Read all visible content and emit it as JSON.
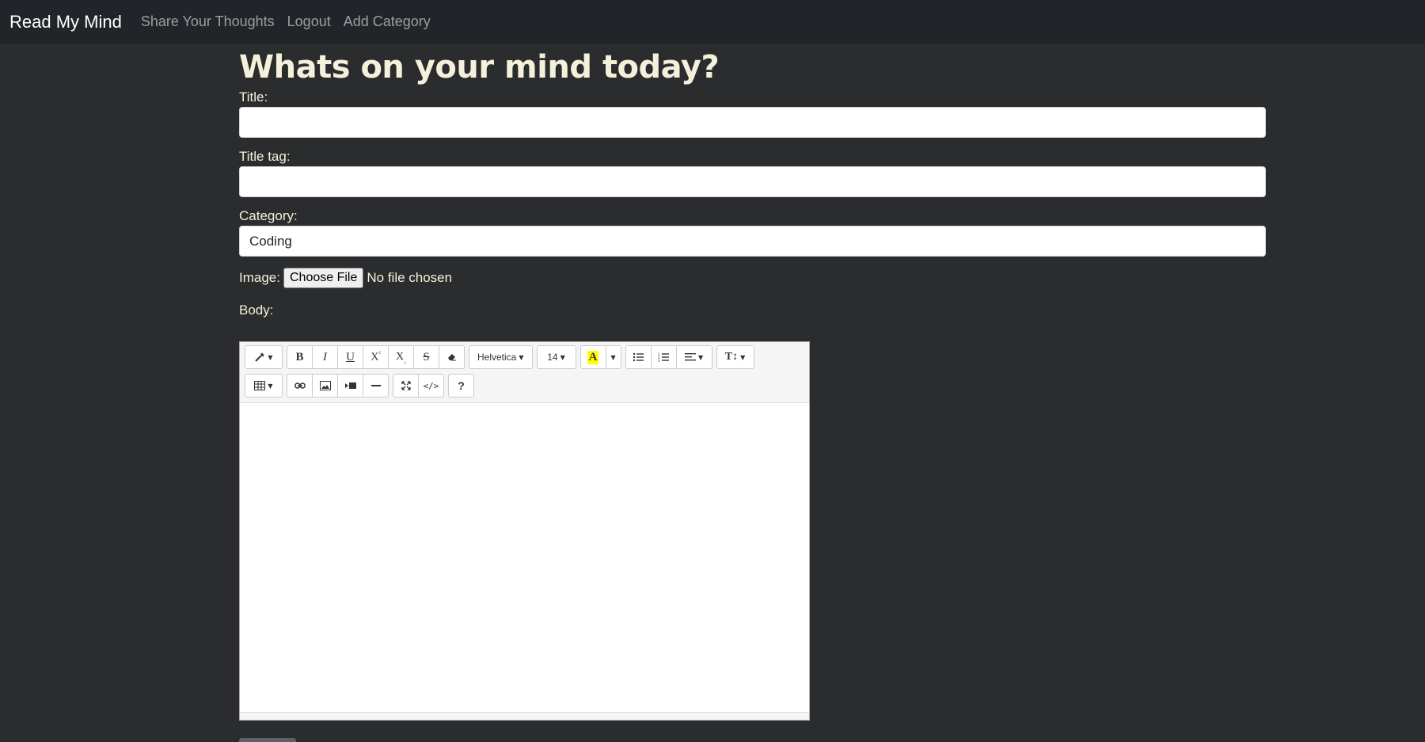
{
  "nav": {
    "brand": "Read My Mind",
    "links": [
      "Share Your Thoughts",
      "Logout",
      "Add Category"
    ]
  },
  "page": {
    "heading": "Whats on your mind today?"
  },
  "form": {
    "title_label": "Title:",
    "title_value": "",
    "title_tag_label": "Title tag:",
    "title_tag_value": "",
    "category_label": "Category:",
    "category_value": "Coding",
    "image_label": "Image:",
    "choose_file_label": "Choose File",
    "no_file_text": "No file chosen",
    "body_label": "Body:"
  },
  "editor": {
    "font_name": "Helvetica",
    "font_size": "14",
    "highlight_color": "#ffff00"
  },
  "colors": {
    "navbar_bg": "#212529",
    "page_bg": "#2b2c2e",
    "heading_text": "#f5f0dc"
  }
}
